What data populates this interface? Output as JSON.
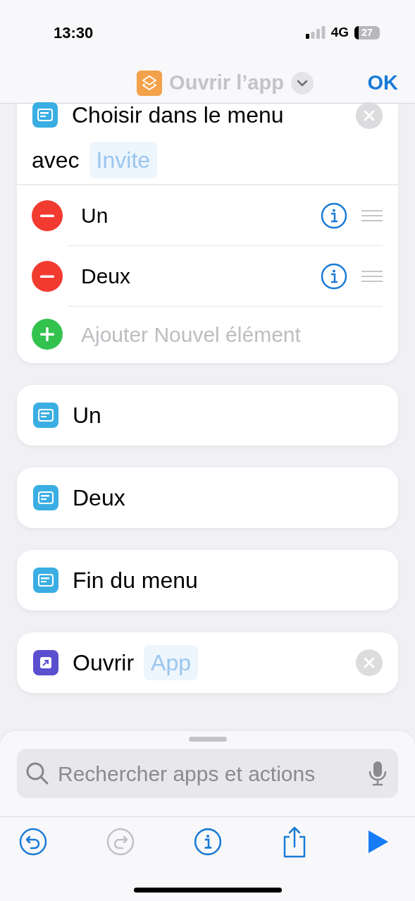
{
  "status_bar": {
    "time": "13:30",
    "network": "4G",
    "battery": "27"
  },
  "nav": {
    "title": "Ouvrir l’app",
    "done": "OK"
  },
  "menu_action": {
    "title": "Choisir dans le menu",
    "prefix": "avec",
    "parameter": "Invite",
    "items": [
      {
        "label": "Un"
      },
      {
        "label": "Deux"
      }
    ],
    "add_label": "Ajouter Nouvel élément"
  },
  "actions": [
    {
      "kind": "menu",
      "label": "Un",
      "removable": false
    },
    {
      "kind": "menu",
      "label": "Deux",
      "removable": false
    },
    {
      "kind": "menu",
      "label": "Fin du menu",
      "removable": false
    },
    {
      "kind": "open",
      "label": "Ouvrir",
      "parameter": "App",
      "removable": true
    }
  ],
  "search": {
    "placeholder": "Rechercher apps et actions"
  },
  "toolbar": [
    {
      "kind": "undo",
      "disabled": false
    },
    {
      "kind": "redo",
      "disabled": true
    },
    {
      "kind": "info",
      "disabled": false
    },
    {
      "kind": "share",
      "disabled": false
    },
    {
      "kind": "run",
      "disabled": false
    }
  ]
}
